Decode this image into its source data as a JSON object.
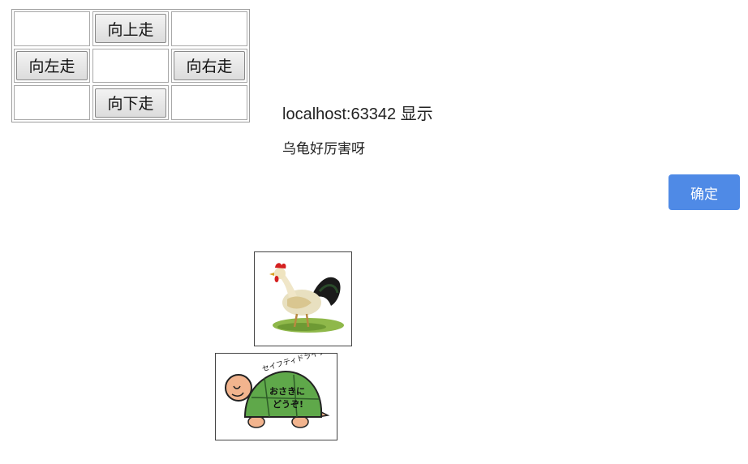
{
  "controls": {
    "up_label": "向上走",
    "left_label": "向左走",
    "right_label": "向右走",
    "down_label": "向下走"
  },
  "alert": {
    "title": "localhost:63342 显示",
    "message": "乌龟好厉害呀",
    "ok_label": "确定",
    "accent_color": "#4f8ae6"
  },
  "images": {
    "rooster": "rooster-image",
    "turtle": "turtle-image",
    "turtle_sign_text_1": "セイフティドライブ",
    "turtle_sign_text_2": "おさきに",
    "turtle_sign_text_3": "どうぞ!"
  }
}
